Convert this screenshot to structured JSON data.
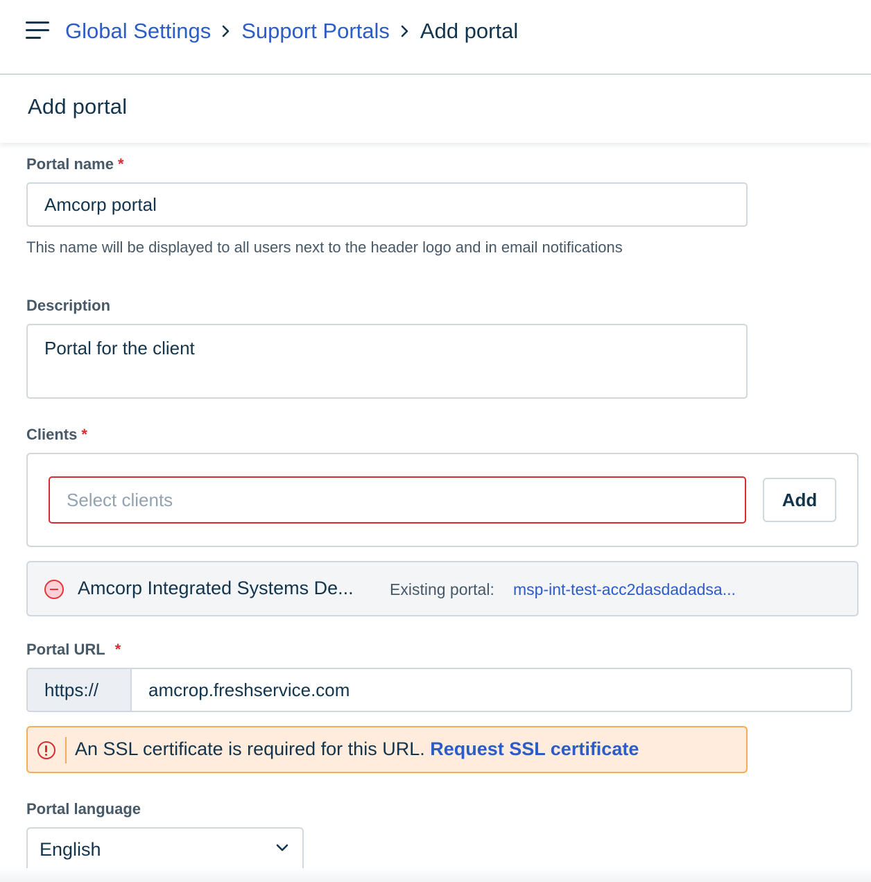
{
  "breadcrumb": {
    "items": [
      "Global Settings",
      "Support Portals"
    ],
    "current": "Add portal"
  },
  "page": {
    "title": "Add portal"
  },
  "form": {
    "portal_name": {
      "label": "Portal name",
      "required_mark": "*",
      "value": "Amcorp portal",
      "hint": "This name will be displayed to all users next to the header logo and in email notifications"
    },
    "description": {
      "label": "Description",
      "value": "Portal for the client"
    },
    "clients": {
      "label": "Clients",
      "required_mark": "*",
      "placeholder": "Select clients",
      "add_label": "Add",
      "selected": [
        {
          "name": "Amcorp Integrated Systems De...",
          "existing_label": "Existing portal:",
          "existing_portal": "msp-int-test-acc2dasdadadsa..."
        }
      ]
    },
    "portal_url": {
      "label": "Portal URL",
      "required_mark": "*",
      "prefix": "https://",
      "value": "amcrop.freshservice.com"
    },
    "ssl_warning": {
      "text": "An SSL certificate is required for this URL.",
      "link": "Request SSL certificate"
    },
    "portal_language": {
      "label": "Portal language",
      "value": "English"
    }
  },
  "colors": {
    "link": "#2c5cc5",
    "required": "#d72d30",
    "error_border": "#d72d30",
    "warning_bg": "#ffecdc",
    "warning_border": "#f8ab59"
  },
  "icons": [
    "hamburger-menu-icon",
    "chevron-right-icon",
    "remove-circle-icon",
    "warning-circle-icon",
    "chevron-down-icon"
  ]
}
